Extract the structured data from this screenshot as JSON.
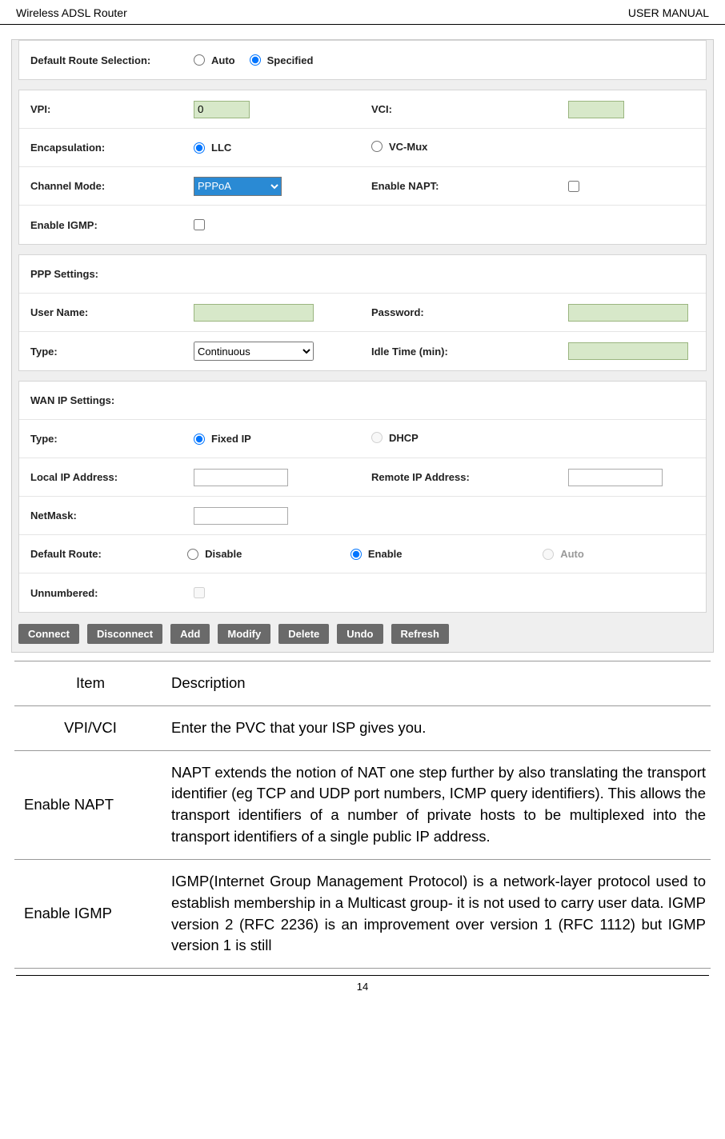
{
  "header": {
    "left": "Wireless ADSL Router",
    "right": "USER MANUAL"
  },
  "panel1": {
    "defaultRouteSelLabel": "Default Route Selection:",
    "autoLabel": "Auto",
    "specifiedLabel": "Specified"
  },
  "panel2": {
    "vpiLabel": "VPI:",
    "vpiValue": "0",
    "vciLabel": "VCI:",
    "vciValue": "",
    "encapLabel": "Encapsulation:",
    "llcLabel": "LLC",
    "vcmuxLabel": "VC-Mux",
    "channelModeLabel": "Channel Mode:",
    "channelModeValue": "PPPoA",
    "enableNaptLabel": "Enable NAPT:",
    "enableIgmpLabel": "Enable IGMP:"
  },
  "panel3": {
    "pppSettingsLabel": "PPP Settings:",
    "userNameLabel": "User Name:",
    "userNameValue": "",
    "passwordLabel": "Password:",
    "passwordValue": "",
    "typeLabel": "Type:",
    "typeValue": "Continuous",
    "idleTimeLabel": "Idle Time (min):",
    "idleTimeValue": ""
  },
  "panel4": {
    "wanIpSettingsLabel": "WAN IP Settings:",
    "typeLabel": "Type:",
    "fixedIpLabel": "Fixed IP",
    "dhcpLabel": "DHCP",
    "localIpLabel": "Local IP Address:",
    "localIpValue": "",
    "remoteIpLabel": "Remote IP Address:",
    "remoteIpValue": "",
    "netmaskLabel": "NetMask:",
    "netmaskValue": "",
    "defaultRouteLabel": "Default Route:",
    "disableLabel": "Disable",
    "enableLabel": "Enable",
    "autoLabel": "Auto",
    "unnumberedLabel": "Unnumbered:"
  },
  "buttons": {
    "connect": "Connect",
    "disconnect": "Disconnect",
    "add": "Add",
    "modify": "Modify",
    "delete": "Delete",
    "undo": "Undo",
    "refresh": "Refresh"
  },
  "descTable": {
    "header": {
      "item": "Item",
      "desc": "Description"
    },
    "rows": [
      {
        "item": "VPI/VCI",
        "desc": "Enter the PVC that your ISP gives you."
      },
      {
        "item": "Enable NAPT",
        "desc": "NAPT extends the notion of NAT one step further by also translating the transport identifier (eg TCP and UDP port numbers, ICMP query identifiers). This allows the transport identifiers of a number of private hosts to be multiplexed into the transport identifiers of a single public IP address."
      },
      {
        "item": "Enable IGMP",
        "desc": "IGMP(Internet Group Management Protocol) is a network-layer protocol used to establish membership in a Multicast group- it is not used to carry user data. IGMP version 2 (RFC 2236) is an improvement over version 1 (RFC 1112) but IGMP version 1 is still"
      }
    ]
  },
  "footer": {
    "pageNumber": "14"
  }
}
